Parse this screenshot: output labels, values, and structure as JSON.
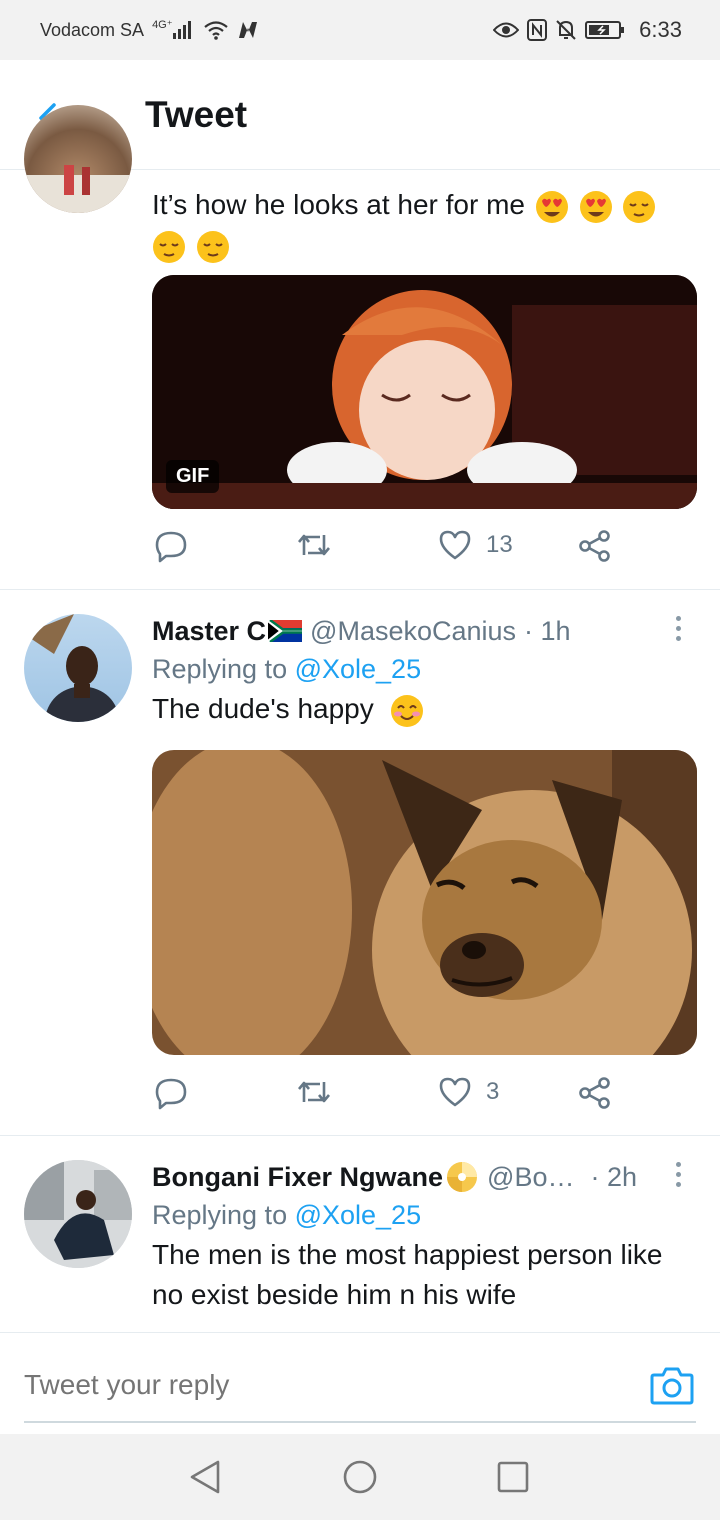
{
  "status_bar": {
    "carrier": "Vodacom SA",
    "network": "4G⁺",
    "time": "6:33"
  },
  "header": {
    "title": "Tweet"
  },
  "tweets": [
    {
      "text": "It’s how he looks at her for me",
      "media_badge": "GIF",
      "like_count": "13"
    },
    {
      "name": "Master C",
      "handle": "@MasekoCanius",
      "time": "· 1h",
      "replying_prefix": "Replying to ",
      "replying_to": "@Xole_25",
      "text": "The dude's happy",
      "like_count": "3"
    },
    {
      "name": "Bongani Fixer Ngwane",
      "handle": "@Bo…",
      "time": "· 2h",
      "replying_prefix": "Replying to ",
      "replying_to": "@Xole_25",
      "text": "The men is the most happiest person like no exist beside him n his wife"
    }
  ],
  "reply_bar": {
    "placeholder": "Tweet your reply"
  },
  "colors": {
    "accent": "#1da1f2",
    "secondary_text": "#657786",
    "primary_text": "#14171a"
  }
}
